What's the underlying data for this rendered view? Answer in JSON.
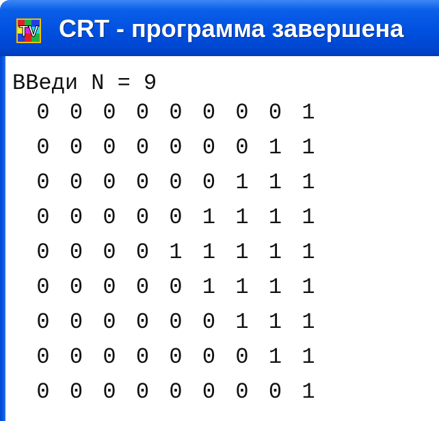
{
  "window": {
    "title": "CRT - программа завершена",
    "icon": "turbo-pascal-tv-icon"
  },
  "console": {
    "prompt": "ВВеди N = 9",
    "matrix": [
      [
        "0",
        "0",
        "0",
        "0",
        "0",
        "0",
        "0",
        "0",
        "1"
      ],
      [
        "0",
        "0",
        "0",
        "0",
        "0",
        "0",
        "0",
        "1",
        "1"
      ],
      [
        "0",
        "0",
        "0",
        "0",
        "0",
        "0",
        "1",
        "1",
        "1"
      ],
      [
        "0",
        "0",
        "0",
        "0",
        "0",
        "1",
        "1",
        "1",
        "1"
      ],
      [
        "0",
        "0",
        "0",
        "0",
        "1",
        "1",
        "1",
        "1",
        "1"
      ],
      [
        "0",
        "0",
        "0",
        "0",
        "0",
        "1",
        "1",
        "1",
        "1"
      ],
      [
        "0",
        "0",
        "0",
        "0",
        "0",
        "0",
        "1",
        "1",
        "1"
      ],
      [
        "0",
        "0",
        "0",
        "0",
        "0",
        "0",
        "0",
        "1",
        "1"
      ],
      [
        "0",
        "0",
        "0",
        "0",
        "0",
        "0",
        "0",
        "0",
        "1"
      ]
    ]
  }
}
